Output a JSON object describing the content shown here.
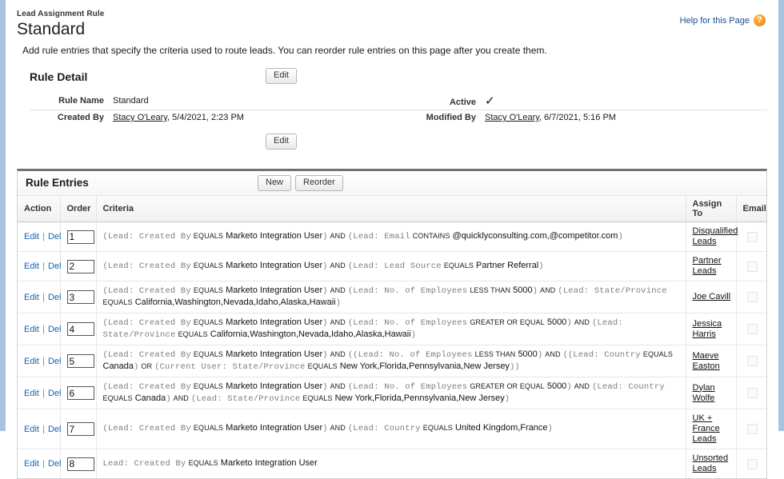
{
  "header": {
    "kicker": "Lead Assignment Rule",
    "title": "Standard",
    "help_label": "Help for this Page",
    "help_icon": "question-mark-icon",
    "intro": "Add rule entries that specify the criteria used to route leads. You can reorder rule entries on this page after you create them."
  },
  "rule_detail": {
    "section_title": "Rule Detail",
    "edit_top_label": "Edit",
    "edit_bottom_label": "Edit",
    "rule_name_label": "Rule Name",
    "rule_name_value": "Standard",
    "active_label": "Active",
    "active_value": "✓",
    "created_by_label": "Created By",
    "created_by_user": "Stacy O'Leary",
    "created_by_rest": ", 5/4/2021, 2:23 PM",
    "modified_by_label": "Modified By",
    "modified_by_user": "Stacy O'Leary",
    "modified_by_rest": ", 6/7/2021, 5:16 PM"
  },
  "rule_entries": {
    "section_title": "Rule Entries",
    "new_label": "New",
    "reorder_label": "Reorder",
    "columns": {
      "action": "Action",
      "order": "Order",
      "criteria": "Criteria",
      "assign_to": "Assign To",
      "email": "Email"
    },
    "action_edit": "Edit",
    "action_sep": "|",
    "action_del": "Del",
    "rows": [
      {
        "order": "1",
        "criteria_html": "<span class='paren'>(</span><span class='mono'>Lead: Created By</span> <span class='op'>EQUALS</span> <span class='val'>Marketo Integration User</span><span class='paren'>)</span> <span class='op'>AND</span> <span class='paren'>(</span><span class='mono'>Lead: Email</span> <span class='op'>CONTAINS</span> <span class='val'>@quicklyconsulting.com,@competitor.com</span><span class='paren'>)</span>",
        "criteria_text": "(Lead: Created By EQUALS Marketo Integration User) AND (Lead: Email CONTAINS @quicklyconsulting.com,@competitor.com)",
        "assign_to": "Disqualified Leads",
        "email_checked": false
      },
      {
        "order": "2",
        "criteria_html": "<span class='paren'>(</span><span class='mono'>Lead: Created By</span> <span class='op'>EQUALS</span> <span class='val'>Marketo Integration User</span><span class='paren'>)</span> <span class='op'>AND</span> <span class='paren'>(</span><span class='mono'>Lead: Lead Source</span> <span class='op'>EQUALS</span> <span class='val'>Partner Referral</span><span class='paren'>)</span>",
        "criteria_text": "(Lead: Created By EQUALS Marketo Integration User) AND (Lead: Lead Source EQUALS Partner Referral)",
        "assign_to": "Partner Leads",
        "email_checked": false
      },
      {
        "order": "3",
        "criteria_html": "<span class='paren'>(</span><span class='mono'>Lead: Created By</span> <span class='op'>EQUALS</span> <span class='val'>Marketo Integration User</span><span class='paren'>)</span> <span class='op'>AND</span> <span class='paren'>(</span><span class='mono'>Lead: No. of Employees</span> <span class='op'>LESS THAN</span> <span class='val'>5000</span><span class='paren'>)</span> <span class='op'>AND</span> <span class='paren'>(</span><span class='mono'>Lead: State/Province</span> <span class='op'>EQUALS</span> <span class='val'>California,Washington,Nevada,Idaho,Alaska,Hawaii</span><span class='paren'>)</span>",
        "criteria_text": "(Lead: Created By EQUALS Marketo Integration User) AND (Lead: No. of Employees LESS THAN 5000) AND (Lead: State/Province EQUALS California,Washington,Nevada,Idaho,Alaska,Hawaii)",
        "assign_to": "Joe Cavill",
        "email_checked": false
      },
      {
        "order": "4",
        "criteria_html": "<span class='paren'>(</span><span class='mono'>Lead: Created By</span> <span class='op'>EQUALS</span> <span class='val'>Marketo Integration User</span><span class='paren'>)</span> <span class='op'>AND</span> <span class='paren'>(</span><span class='mono'>Lead: No. of Employees</span> <span class='op'>GREATER OR EQUAL</span> <span class='val'>5000</span><span class='paren'>)</span> <span class='op'>AND</span> <span class='paren'>(</span><span class='mono'>Lead: State/Province</span> <span class='op'>EQUALS</span> <span class='val'>California,Washington,Nevada,Idaho,Alaska,Hawaii</span><span class='paren'>)</span>",
        "criteria_text": "(Lead: Created By EQUALS Marketo Integration User) AND (Lead: No. of Employees GREATER OR EQUAL 5000) AND (Lead: State/Province EQUALS California,Washington,Nevada,Idaho,Alaska,Hawaii)",
        "assign_to": "Jessica Harris",
        "email_checked": false
      },
      {
        "order": "5",
        "criteria_html": "<span class='paren'>(</span><span class='mono'>Lead: Created By</span> <span class='op'>EQUALS</span> <span class='val'>Marketo Integration User</span><span class='paren'>)</span> <span class='op'>AND</span> <span class='paren'>((</span><span class='mono'>Lead: No. of Employees</span> <span class='op'>LESS THAN</span> <span class='val'>5000</span><span class='paren'>)</span> <span class='op'>AND</span> <span class='paren'>((</span><span class='mono'>Lead: Country</span> <span class='op'>EQUALS</span> <span class='val'>Canada</span><span class='paren'>)</span> <span class='op'>OR</span> <span class='paren'>(</span><span class='mono'>Current User: State/Province</span> <span class='op'>EQUALS</span> <span class='val'>New York,Florida,Pennsylvania,New Jersey</span><span class='paren'>))</span>",
        "criteria_text": "(Lead: Created By EQUALS Marketo Integration User) AND (Lead: No. of Employees LESS THAN 5000) AND ((Lead: Country EQUALS Canada) OR (Current User: State/Province EQUALS New York,Florida,Pennsylvania,New Jersey))",
        "assign_to": "Maeve Easton",
        "email_checked": false
      },
      {
        "order": "6",
        "criteria_html": "<span class='paren'>(</span><span class='mono'>Lead: Created By</span> <span class='op'>EQUALS</span> <span class='val'>Marketo Integration User</span><span class='paren'>)</span> <span class='op'>AND</span> <span class='paren'>(</span><span class='mono'>Lead: No. of Employees</span> <span class='op'>GREATER OR EQUAL</span> <span class='val'>5000</span><span class='paren'>)</span> <span class='op'>AND</span> <span class='paren'>(</span><span class='mono'>Lead: Country</span> <span class='op'>EQUALS</span> <span class='val'>Canada</span><span class='paren'>)</span> <span class='op'>AND</span> <span class='paren'>(</span><span class='mono'>Lead: State/Province</span> <span class='op'>EQUALS</span> <span class='val'>New York,Florida,Pennsylvania,New Jersey</span><span class='paren'>)</span>",
        "criteria_text": "(Lead: Created By EQUALS Marketo Integration User) AND (Lead: No. of Employees GREATER OR EQUAL 5000) AND (Lead: Country EQUALS Canada) AND (Lead: State/Province EQUALS New York,Florida,Pennsylvania,New Jersey)",
        "assign_to": "Dylan Wolfe",
        "email_checked": false
      },
      {
        "order": "7",
        "criteria_html": "<span class='paren'>(</span><span class='mono'>Lead: Created By</span> <span class='op'>EQUALS</span> <span class='val'>Marketo Integration User</span><span class='paren'>)</span> <span class='op'>AND</span> <span class='paren'>(</span><span class='mono'>Lead: Country</span> <span class='op'>EQUALS</span> <span class='val'>United Kingdom,France</span><span class='paren'>)</span>",
        "criteria_text": "(Lead: Created By EQUALS Marketo Integration User) AND (Lead: Country EQUALS United Kingdom,France)",
        "assign_to": "UK + France Leads",
        "email_checked": false
      },
      {
        "order": "8",
        "criteria_html": "<span class='mono'>Lead: Created By</span> <span class='op'>EQUALS</span> <span class='val'>Marketo Integration User</span>",
        "criteria_text": "Lead: Created By EQUALS Marketo Integration User",
        "assign_to": "Unsorted Leads",
        "email_checked": false
      }
    ]
  }
}
